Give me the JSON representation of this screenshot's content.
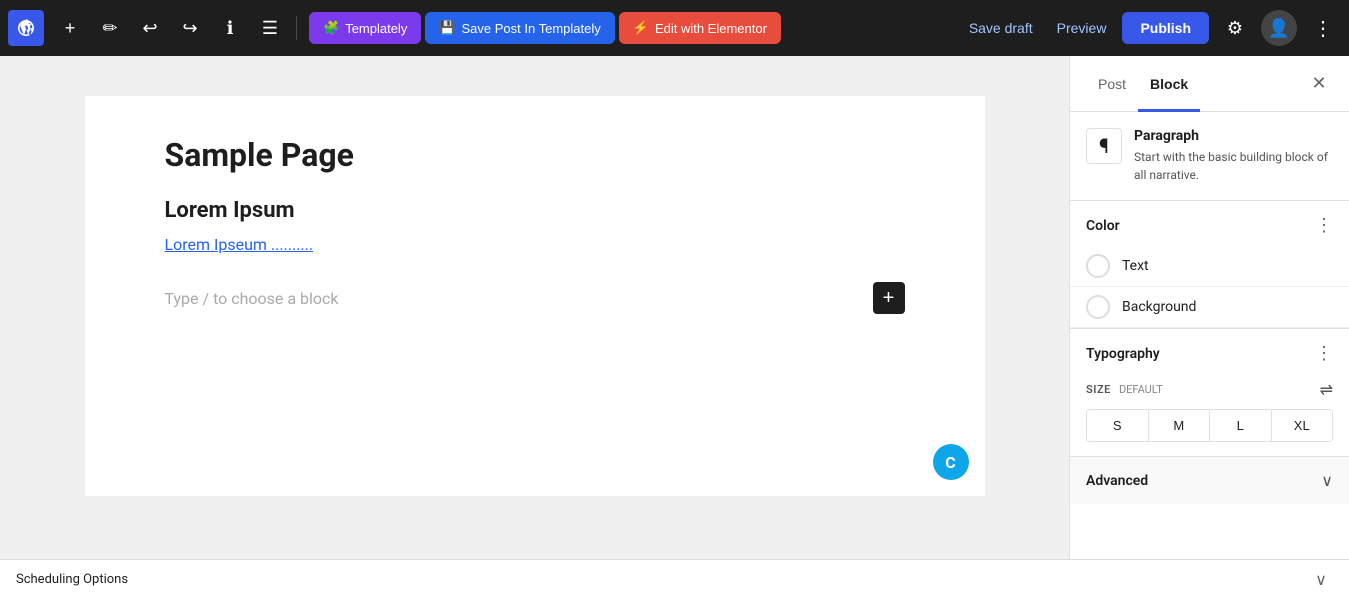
{
  "toolbar": {
    "wp_logo_alt": "WordPress Logo",
    "add_label": "+",
    "edit_label": "✏",
    "undo_label": "↩",
    "redo_label": "↪",
    "info_label": "ℹ",
    "list_label": "☰",
    "templately_label": "Templately",
    "save_post_templately_label": "Save Post In Templately",
    "edit_elementor_label": "Edit with Elementor",
    "save_draft_label": "Save draft",
    "preview_label": "Preview",
    "publish_label": "Publish",
    "settings_label": "⚙",
    "user_label": "👤",
    "more_label": "⋮"
  },
  "editor": {
    "page_title": "Sample Page",
    "block_heading": "Lorem Ipsum",
    "block_link_text": "Lorem Ipseum ..........",
    "placeholder_text": "Type / to choose a block",
    "add_block_label": "+"
  },
  "bottom_bar": {
    "scheduling_options_label": "Scheduling Options",
    "chevron_down": "∨"
  },
  "sidebar": {
    "tab_post_label": "Post",
    "tab_block_label": "Block",
    "close_label": "✕",
    "block_icon": "¶",
    "block_name": "Paragraph",
    "block_description": "Start with the basic building block of all narrative.",
    "color_section_title": "Color",
    "color_more": "⋮",
    "color_text_label": "Text",
    "color_background_label": "Background",
    "typography_section_title": "Typography",
    "typography_more": "⋮",
    "size_label": "SIZE",
    "size_default_label": "DEFAULT",
    "size_controls": "⇌",
    "font_sizes": [
      "S",
      "M",
      "L",
      "XL"
    ],
    "advanced_label": "Advanced",
    "advanced_chevron": "∨",
    "teal_icon": "C"
  }
}
